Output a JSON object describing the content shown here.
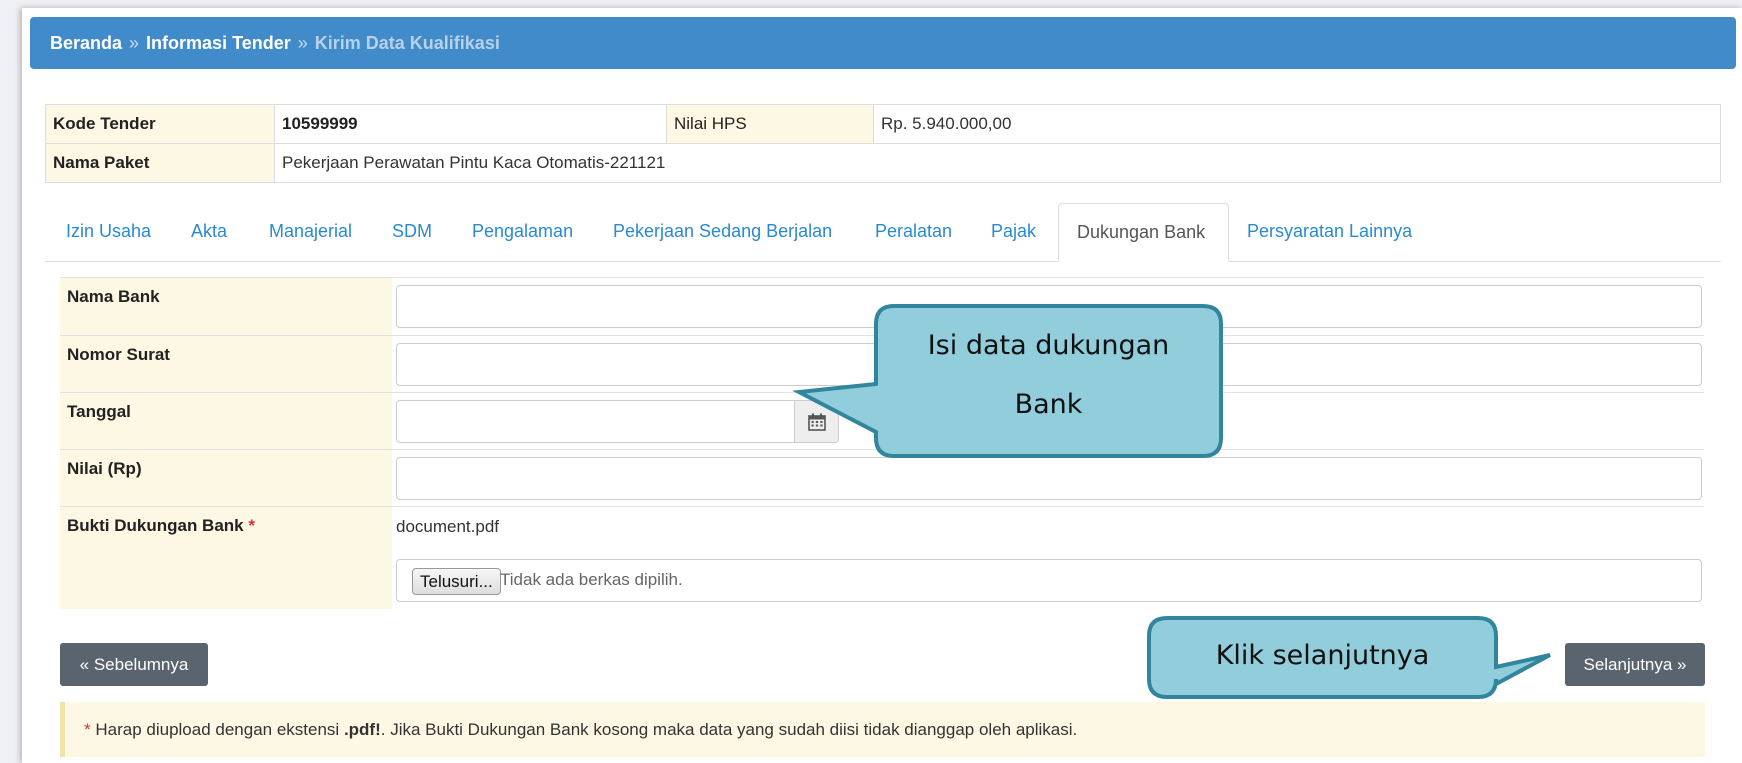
{
  "breadcrumb": {
    "home": "Beranda",
    "separator": "»",
    "parent": "Informasi Tender",
    "current": "Kirim Data Kualifikasi"
  },
  "tender_info": {
    "kode_label": "Kode Tender",
    "kode_value": "10599999",
    "hps_label": "Nilai HPS",
    "hps_value": "Rp. 5.940.000,00",
    "paket_label": "Nama Paket",
    "paket_value": "Pekerjaan Perawatan Pintu Kaca Otomatis-221121"
  },
  "tabs": [
    {
      "label": "Izin Usaha"
    },
    {
      "label": "Akta"
    },
    {
      "label": "Manajerial"
    },
    {
      "label": "SDM"
    },
    {
      "label": "Pengalaman"
    },
    {
      "label": "Pekerjaan Sedang Berjalan"
    },
    {
      "label": "Peralatan"
    },
    {
      "label": "Pajak"
    },
    {
      "label": "Dukungan Bank"
    },
    {
      "label": "Persyaratan Lainnya"
    }
  ],
  "active_tab": "Dukungan Bank",
  "form": {
    "nama_bank_label": "Nama Bank",
    "nama_bank_value": "",
    "nomor_surat_label": "Nomor Surat",
    "nomor_surat_value": "",
    "tanggal_label": "Tanggal",
    "tanggal_value": "",
    "nilai_label": "Nilai (Rp)",
    "nilai_value": "",
    "bukti_label": "Bukti Dukungan Bank",
    "required_marker": "*",
    "bukti_filename": "document.pdf",
    "browse_label": "Telusuri...",
    "no_file_text": "Tidak ada berkas dipilih."
  },
  "buttons": {
    "prev": "« Sebelumnya",
    "next": "Selanjutnya »"
  },
  "notice": {
    "star": "*",
    "prefix": "Harap diupload dengan ekstensi",
    "ext": ".pdf!",
    "suffix": ". Jika Bukti Dukungan Bank kosong maka data yang sudah diisi tidak dianggap oleh aplikasi."
  },
  "callouts": {
    "fill_line1": "Isi data dukungan",
    "fill_line2": "Bank",
    "next": "Klik selanjutnya"
  },
  "icons": {
    "calendar": "calendar-icon"
  },
  "colors": {
    "header_blue": "#428bca",
    "label_bg": "#fcf8e3",
    "tab_link": "#2a8ad0",
    "button_gray": "#5a646e",
    "callout_fill": "#92cddc",
    "callout_border": "#31859c"
  }
}
